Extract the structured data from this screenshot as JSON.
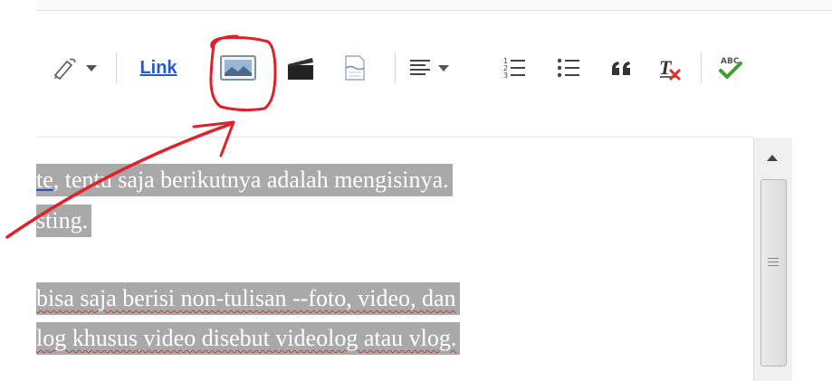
{
  "toolbar": {
    "link_label": "Link",
    "icons": {
      "text_color": "text-color-pencil-icon",
      "dropdown": "chevron-down-icon",
      "insert_image": "insert-image-icon",
      "insert_video": "insert-video-icon",
      "jump_break": "jump-break-icon",
      "align": "align-icon",
      "numbered_list": "numbered-list-icon",
      "bullet_list": "bullet-list-icon",
      "quote": "quote-icon",
      "clear_format": "clear-formatting-icon",
      "spellcheck": "spellcheck-icon"
    }
  },
  "editor": {
    "lines": [
      {
        "p1": "te",
        "p2": ", tentu saja berikutnya adalah mengisinya."
      },
      {
        "p1": "sting."
      },
      {
        "p1": " bisa saja berisi non-tulisan --foto, video, dan"
      },
      {
        "p1": "log khusus video disebut videolog atau vlog."
      }
    ]
  },
  "colors": {
    "link": "#2b58c9",
    "highlight": "#a9a9a9",
    "annotation": "#e0202a",
    "spell_error": "#d6352a"
  }
}
